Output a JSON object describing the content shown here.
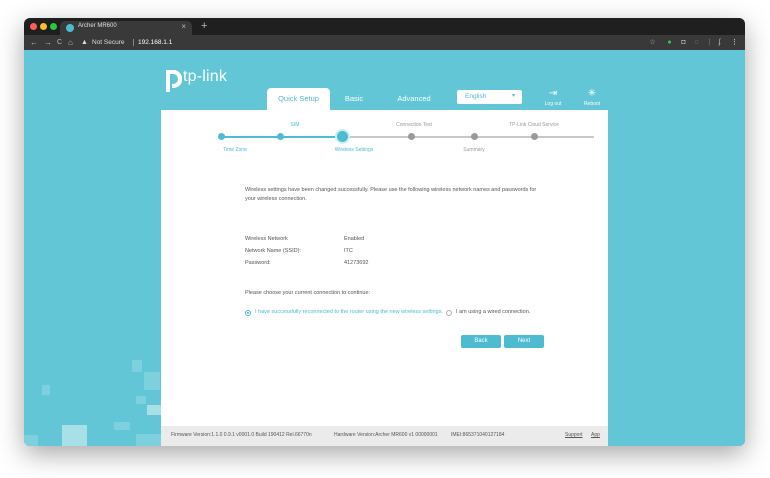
{
  "browser": {
    "tab_title": "Archer MR600",
    "tab_close": "×",
    "new_tab": "+",
    "back": "←",
    "forward": "→",
    "reload": "C",
    "home": "⌂",
    "security_warning_icon": "▲",
    "security_label": "Not Secure",
    "url": "192.168.1.1",
    "star": "☆",
    "menu": "⋮"
  },
  "brand": {
    "logo_text": "tp-link",
    "accent_color": "#4ebbd0",
    "background_color": "#62c6d6"
  },
  "nav": {
    "tabs": [
      "Quick Setup",
      "Basic",
      "Advanced"
    ],
    "active_tab": "Quick Setup",
    "language": "English",
    "logout_label": "Log out",
    "reboot_label": "Reboot"
  },
  "steps": {
    "top_labels": [
      "SIM",
      "Connection Test",
      "TP-Link Cloud Service"
    ],
    "bottom_labels": [
      "Time Zone",
      "Wireless Settings",
      "Summary"
    ],
    "current": "Wireless Settings"
  },
  "main": {
    "message": "Wireless settings have been changed successfully. Please use the following wireless network names and passwords for your wireless connection.",
    "fields": [
      {
        "label": "Wireless Network",
        "value": "Enabled"
      },
      {
        "label": "Network Name (SSID):",
        "value": "ITC"
      },
      {
        "label": "Password:",
        "value": "41273692"
      }
    ],
    "choose_prompt": "Please choose your current connection to continue:",
    "options": [
      {
        "label": "I have successfully reconnected to the router using the new wireless settings.",
        "selected": true
      },
      {
        "label": "I am using a wired connection.",
        "selected": false
      }
    ],
    "back_button": "Back",
    "next_button": "Next"
  },
  "footer": {
    "firmware": "Firmware Version:1.1.0 0.9.1 v0001.0 Build 190412 Rel.66770n",
    "hardware": "Hardware Version:Archer MR600 v1 00000001",
    "imei": "IMEI:865371040127184",
    "support": "Support",
    "app": "App"
  }
}
